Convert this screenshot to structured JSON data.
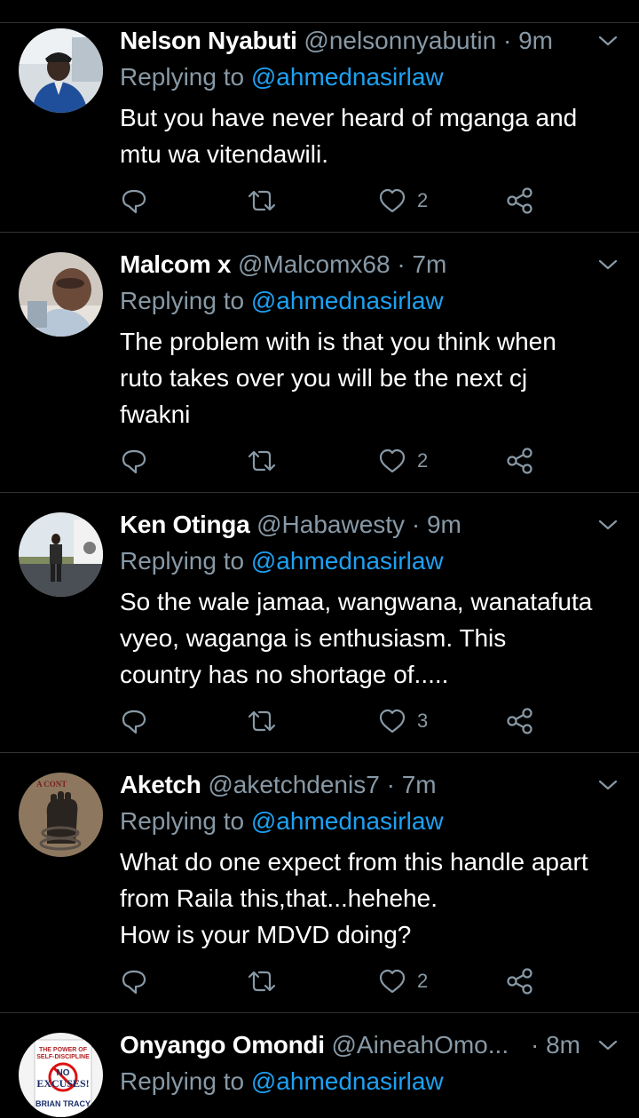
{
  "replies": [
    {
      "name": "Nelson Nyabuti",
      "handle": "@nelsonnyabutin",
      "separator": "·",
      "time": "9m",
      "replying_prefix": "Replying to",
      "replying_to": "@ahmednasirlaw",
      "text": "But you have never heard of mganga and\nmtu wa vitendawili.",
      "likes": "2"
    },
    {
      "name": "Malcom x",
      "handle": "@Malcomx68",
      "separator": "·",
      "time": "7m",
      "replying_prefix": "Replying to",
      "replying_to": "@ahmednasirlaw",
      "text": "The problem with is that you think when\nruto takes over you will be the next cj\nfwakni",
      "likes": "2"
    },
    {
      "name": "Ken Otinga",
      "handle": "@Habawesty",
      "separator": "·",
      "time": "9m",
      "replying_prefix": "Replying to",
      "replying_to": "@ahmednasirlaw",
      "text": "So the wale jamaa, wangwana, wanatafuta\nvyeo, waganga is enthusiasm. This\ncountry has no shortage of.....",
      "likes": "3"
    },
    {
      "name": "Aketch",
      "handle": "@aketchdenis7",
      "separator": "·",
      "time": "7m",
      "replying_prefix": "Replying to",
      "replying_to": "@ahmednasirlaw",
      "text": "What do one expect from this handle apart\nfrom Raila this,that...hehehe.\nHow is your MDVD doing?",
      "likes": "2",
      "avatar_text": "A CONT"
    },
    {
      "name": "Onyango Omondi",
      "handle": "@AineahOmo...",
      "separator": "·",
      "time": "8m",
      "replying_prefix": "Replying to",
      "replying_to": "@ahmednasirlaw",
      "text": "",
      "likes": "",
      "avatar_text": {
        "line1": "THE POWER OF",
        "line2": "SELF-DISCIPLINE",
        "line3": "NO",
        "line4": "EXCUSES!",
        "line5": "BRIAN TRACY"
      }
    }
  ],
  "colors": {
    "background": "#000000",
    "primary_text": "#ffffff",
    "secondary_text": "#8899a6",
    "mention": "#1da1f2",
    "divider": "#2f3336"
  },
  "icons": [
    "chevron-down-icon",
    "reply-icon",
    "retweet-icon",
    "like-icon",
    "share-icon"
  ]
}
